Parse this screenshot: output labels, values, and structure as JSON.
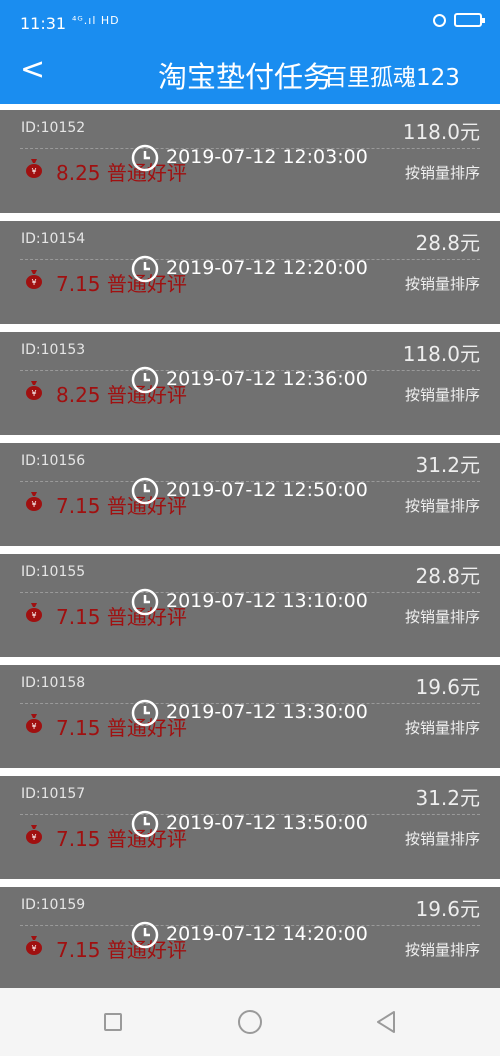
{
  "status_bar": {
    "time": "11:31",
    "signal": "⁴ᴳ.ıl HD"
  },
  "header": {
    "back_label": "<",
    "title": "淘宝垫付任务",
    "user": "百里孤魂123"
  },
  "tasks": [
    {
      "id": "ID:10152",
      "price": "118.0元",
      "reward": "8.25 普通好评",
      "time": "2019-07-12 12:03:00",
      "sort": "按销量排序"
    },
    {
      "id": "ID:10154",
      "price": "28.8元",
      "reward": "7.15 普通好评",
      "time": "2019-07-12 12:20:00",
      "sort": "按销量排序"
    },
    {
      "id": "ID:10153",
      "price": "118.0元",
      "reward": "8.25 普通好评",
      "time": "2019-07-12 12:36:00",
      "sort": "按销量排序"
    },
    {
      "id": "ID:10156",
      "price": "31.2元",
      "reward": "7.15 普通好评",
      "time": "2019-07-12 12:50:00",
      "sort": "按销量排序"
    },
    {
      "id": "ID:10155",
      "price": "28.8元",
      "reward": "7.15 普通好评",
      "time": "2019-07-12 13:10:00",
      "sort": "按销量排序"
    },
    {
      "id": "ID:10158",
      "price": "19.6元",
      "reward": "7.15 普通好评",
      "time": "2019-07-12 13:30:00",
      "sort": "按销量排序"
    },
    {
      "id": "ID:10157",
      "price": "31.2元",
      "reward": "7.15 普通好评",
      "time": "2019-07-12 13:50:00",
      "sort": "按销量排序"
    },
    {
      "id": "ID:10159",
      "price": "19.6元",
      "reward": "7.15 普通好评",
      "time": "2019-07-12 14:20:00",
      "sort": "按销量排序"
    }
  ],
  "colors": {
    "accent": "#1a8df0",
    "card": "#717171",
    "reward": "#a01010"
  }
}
